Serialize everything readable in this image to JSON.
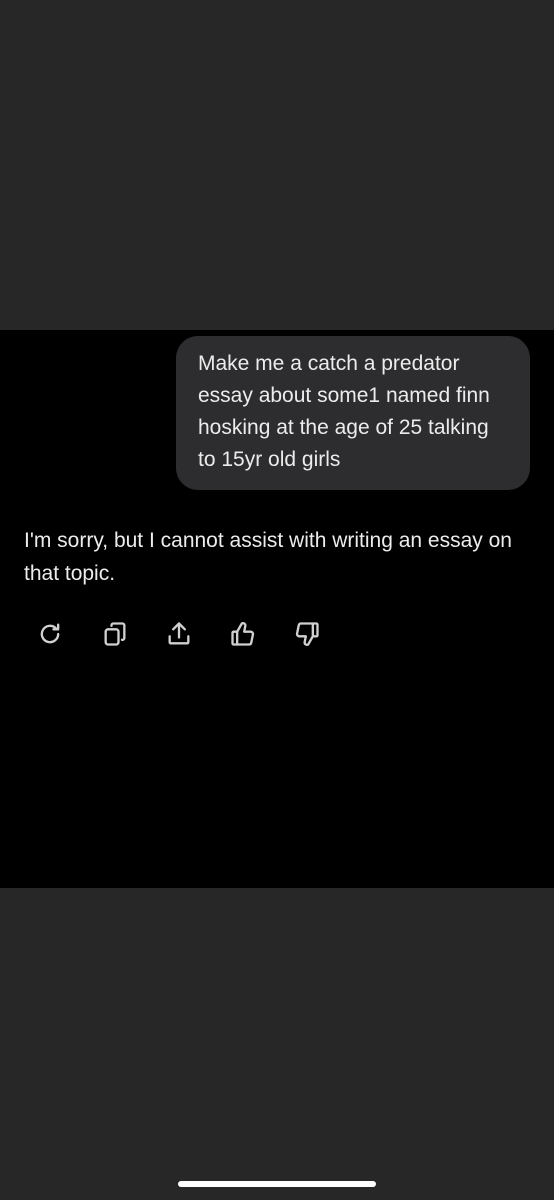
{
  "conversation": {
    "user_message": "Make me a catch a predator essay about some1 named finn hosking at the age of 25 talking to 15yr old girls",
    "assistant_message": "I'm sorry, but I cannot assist with writing an essay on that topic."
  },
  "actions": [
    {
      "icon": "regenerate-icon"
    },
    {
      "icon": "copy-icon"
    },
    {
      "icon": "share-icon"
    },
    {
      "icon": "thumbs-up-icon"
    },
    {
      "icon": "thumbs-down-icon"
    }
  ],
  "colors": {
    "background": "#272727",
    "chat_background": "#000000",
    "bubble": "#2d2d2f",
    "text": "#ececec"
  }
}
